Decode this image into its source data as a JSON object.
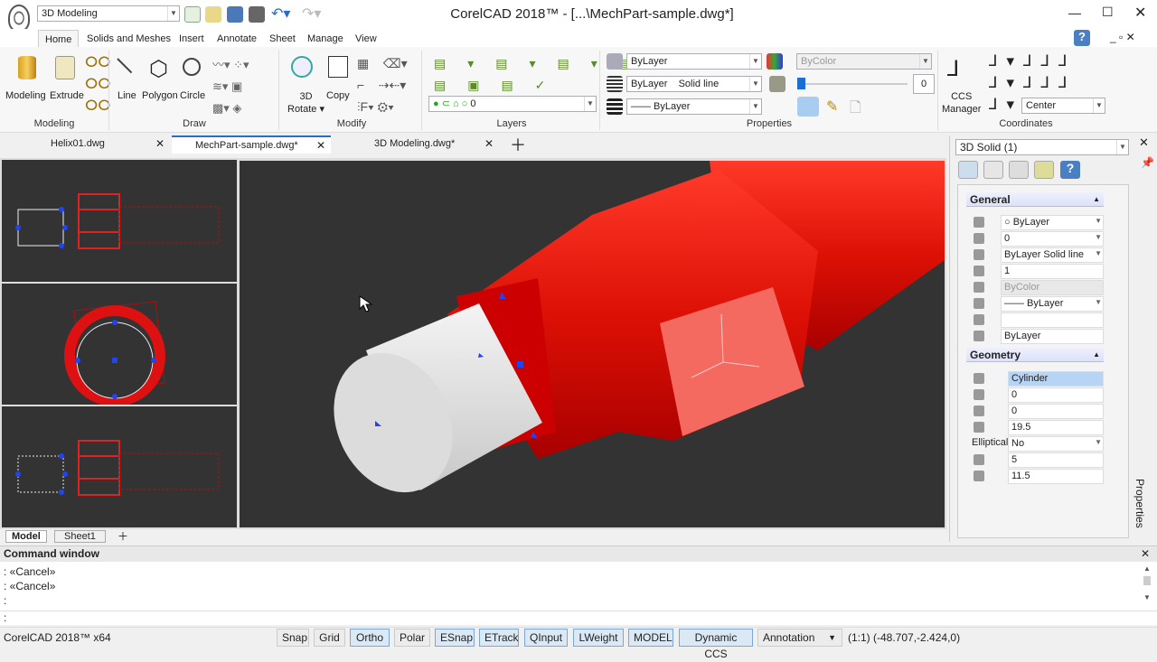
{
  "app": {
    "title": "CorelCAD 2018™ - [...\\MechPart-sample.dwg*]",
    "workspace": "3D Modeling"
  },
  "menu_tabs": [
    {
      "label": "Home",
      "active": true
    },
    {
      "label": "Solids and Meshes"
    },
    {
      "label": "Insert"
    },
    {
      "label": "Annotate"
    },
    {
      "label": "Sheet"
    },
    {
      "label": "Manage"
    },
    {
      "label": "View"
    }
  ],
  "ribbon": {
    "groups": [
      "Modeling",
      "Draw",
      "Modify",
      "Layers",
      "Properties",
      "Coordinates"
    ],
    "modeling": {
      "modeling": "Modeling",
      "extrude": "Extrude"
    },
    "draw": {
      "line": "Line",
      "polygon": "Polygon",
      "circle": "Circle"
    },
    "modify": {
      "rotate1": "3D",
      "rotate2": "Rotate",
      "copy": "Copy"
    },
    "layers": {
      "layer_combo": "0"
    },
    "properties": {
      "color": "ByLayer",
      "linetype_a": "ByLayer",
      "linetype_b": "Solid line",
      "lineweight": "—— ByLayer",
      "plotstyle": "ByColor",
      "transparency": "0",
      "transparency_value": 0
    },
    "coordinates": {
      "ccs1": "CCS",
      "ccs2": "Manager",
      "view": "Center"
    }
  },
  "doc_tabs": [
    {
      "label": "Helix01.dwg"
    },
    {
      "label": "MechPart-sample.dwg*",
      "active": true
    },
    {
      "label": "3D Modeling.dwg*"
    }
  ],
  "layout_tabs": [
    "Model",
    "Sheet1"
  ],
  "properties_panel": {
    "selection": "3D Solid (1)",
    "side_label": "Properties",
    "general_title": "General",
    "general": [
      {
        "icon": "color-icon",
        "value": "○ ByLayer",
        "dd": true
      },
      {
        "icon": "layer-icon",
        "value": "0",
        "dd": true
      },
      {
        "icon": "linetype-icon",
        "value": "ByLayer     Solid line",
        "dd": true
      },
      {
        "icon": "linetype-scale-icon",
        "value": "1"
      },
      {
        "icon": "plotstyle-icon",
        "value": "ByColor",
        "disabled": true
      },
      {
        "icon": "lineweight-icon",
        "value": "—— ByLayer",
        "dd": true
      },
      {
        "icon": "hyperlink-icon",
        "value": ""
      },
      {
        "icon": "material-icon",
        "value": "ByLayer"
      }
    ],
    "geometry_title": "Geometry",
    "geometry": [
      {
        "icon": "type-icon",
        "value": "Cylinder",
        "selected": true
      },
      {
        "icon": "x-icon",
        "label": "",
        "value": "0"
      },
      {
        "icon": "y-icon",
        "value": "0"
      },
      {
        "icon": "z-icon",
        "value": "19.5"
      },
      {
        "label": "Elliptical",
        "value": "No",
        "dd": true
      },
      {
        "icon": "radius-icon",
        "value": "5"
      },
      {
        "icon": "height-icon",
        "value": "11.5"
      }
    ]
  },
  "command_window": {
    "title": "Command window",
    "lines": [
      ": «Cancel»",
      ": «Cancel»",
      ":"
    ],
    "prompt": ":"
  },
  "status": {
    "app": "CorelCAD 2018™ x64",
    "buttons": [
      {
        "label": "Snap",
        "on": false
      },
      {
        "label": "Grid",
        "on": false
      },
      {
        "label": "Ortho",
        "on": true
      },
      {
        "label": "Polar",
        "on": false
      },
      {
        "label": "ESnap",
        "on": true
      },
      {
        "label": "ETrack",
        "on": true
      },
      {
        "label": "QInput",
        "on": true
      },
      {
        "label": "LWeight",
        "on": true
      },
      {
        "label": "MODEL",
        "on": true
      },
      {
        "label": "Dynamic CCS",
        "on": true
      }
    ],
    "annotation": "Annotation",
    "coords": "(1:1) (-48.707,-2.424,0)"
  },
  "colors": {
    "accent": "#2b6cc4",
    "model": "#e01010",
    "viewport_bg": "#333333",
    "cylinder": "#e8e8e8"
  }
}
